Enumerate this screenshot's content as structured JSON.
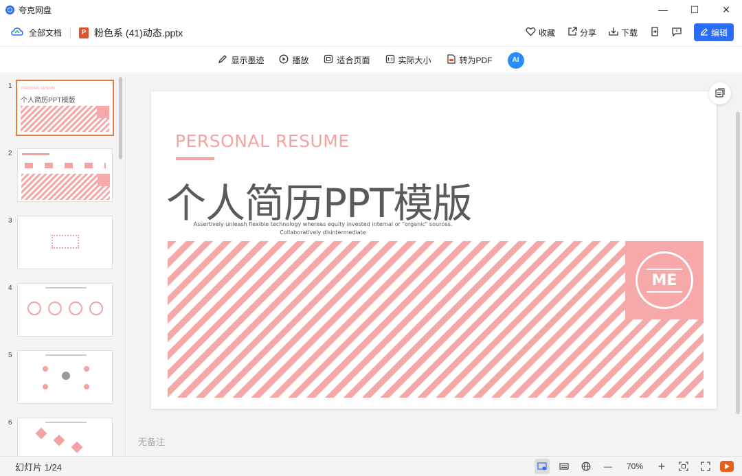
{
  "app": {
    "name": "夸克网盘"
  },
  "window_controls": [
    "—",
    "☐",
    "✕"
  ],
  "header": {
    "all_docs": "全部文档",
    "file_name": "粉色系 (41)动态.pptx",
    "ppt_badge": "P",
    "actions": {
      "favorite": "收藏",
      "share": "分享",
      "download": "下载",
      "edit": "编辑"
    }
  },
  "view_toolbar": {
    "show_ink": "显示墨迹",
    "play": "播放",
    "fit_page": "适合页面",
    "actual_size": "实际大小",
    "to_pdf": "转为PDF",
    "ai": "AI"
  },
  "thumbnails": [
    {
      "num": "1",
      "title": "个人简历PPT模版",
      "tag": "PERSONAL RESUME",
      "active": true
    },
    {
      "num": "2",
      "title": "",
      "tag": "",
      "active": false
    },
    {
      "num": "3",
      "title": "",
      "tag": "",
      "active": false
    },
    {
      "num": "4",
      "title": "",
      "tag": "",
      "active": false
    },
    {
      "num": "5",
      "title": "",
      "tag": "",
      "active": false
    },
    {
      "num": "6",
      "title": "",
      "tag": "",
      "active": false
    }
  ],
  "slide": {
    "tag": "PERSONAL  RESUME",
    "title": "个人简历PPT模版",
    "subtitle": "Assertively unleash flexible technology whereas equity invested internal or \"organic\" sources. Collaboratively disintermediate",
    "badge": "ME"
  },
  "notes": "无备注",
  "status": {
    "slide_count": "幻灯片 1/24",
    "zoom": "70%",
    "zoom_out": "—",
    "zoom_in": "+"
  },
  "colors": {
    "accent": "#2a6cf6",
    "pink": "#f4a8a8",
    "ppt": "#e0532d",
    "play": "#e8611a"
  }
}
